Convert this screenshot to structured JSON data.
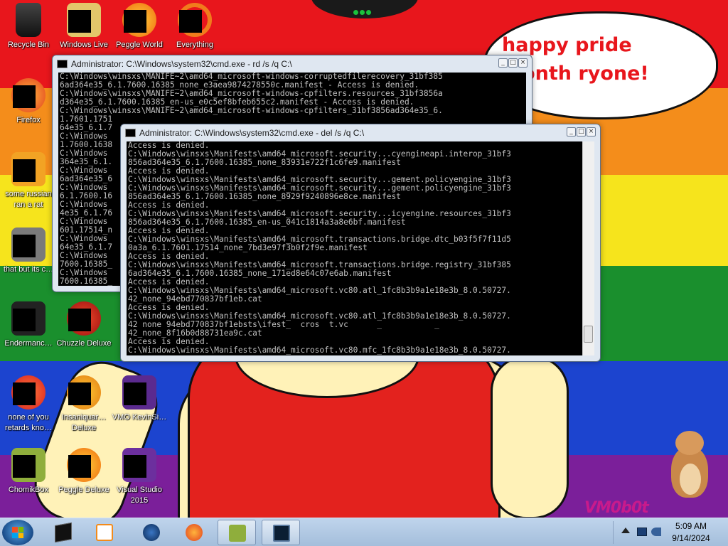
{
  "wallpaper": {
    "speech_bubble": "happy pride month ryone!",
    "watermark": "VM0b0t",
    "stripe_colors": [
      "#e8161c",
      "#f48d1b",
      "#f6e41c",
      "#1a8f2d",
      "#1c44cf",
      "#7b1f9a"
    ]
  },
  "desktop_icons": [
    {
      "label": "Recycle Bin",
      "icon": "recycle-bin-icon"
    },
    {
      "label": "Windows Live",
      "icon": "windows-live-icon"
    },
    {
      "label": "Peggle World",
      "icon": "peggle-world-icon"
    },
    {
      "label": "Everything",
      "icon": "everything-search-icon"
    },
    {
      "label": "Firefox",
      "icon": "firefox-icon"
    },
    {
      "label": "some russian ran a rat",
      "icon": "file-icon"
    },
    {
      "label": "that but its c…",
      "icon": "file-stack-icon"
    },
    {
      "label": "Endermanc…",
      "icon": "app-window-icon"
    },
    {
      "label": "Chuzzle Deluxe",
      "icon": "chuzzle-icon"
    },
    {
      "label": "none of you retards kno…",
      "icon": "browser-icon"
    },
    {
      "label": "Insaniquar… Deluxe",
      "icon": "insaniquarium-icon"
    },
    {
      "label": "VMO KevinSi…",
      "icon": "purple-app-icon"
    },
    {
      "label": "ChomikBox",
      "icon": "chomikbox-icon"
    },
    {
      "label": "Peggle Deluxe",
      "icon": "peggle-deluxe-icon"
    },
    {
      "label": "Visual Studio 2015",
      "icon": "visual-studio-icon"
    }
  ],
  "window_back": {
    "title": "Administrator: C:\\Windows\\system32\\cmd.exe - rd  /s /q C:\\",
    "lines": "C:\\Windows\\winsxs\\MANIFE~2\\amd64_microsoft-windows-corruptedfilerecovery_31bf385\n6ad364e35_6.1.7600.16385_none_e3aea9874278550c.manifest - Access is denied.\nC:\\Windows\\winsxs\\MANIFE~2\\amd64_microsoft-windows-cpfilters.resources_31bf3856a\nd364e35_6.1.7600.16385_en-us_e0c5ef8bfeb655c2.manifest - Access is denied.\nC:\\Windows\\winsxs\\MANIFE~2\\amd64_microsoft-windows-cpfilters_31bf3856ad364e35_6.\n1.7601.1751\n64e35_6.1.7\nC:\\Windows\n1.7600.1638\nC:\\Windows\n364e35_6.1.\nC:\\Windows\n6ad364e35_6\nC:\\Windows\n6.1.7600.16\nC:\\Windows\n4e35_6.1.76\nC:\\Windows\n601.17514_n\nC:\\Windows\n64e35_6.1.7\nC:\\Windows\n7600.16385_\nC:\\Windows\n7600.16385_"
  },
  "window_front": {
    "title": "Administrator: C:\\Windows\\system32\\cmd.exe - del  /s /q C:\\",
    "lines": "Access is denied.\nC:\\Windows\\winsxs\\Manifests\\amd64_microsoft.security...cyengineapi.interop_31bf3\n856ad364e35_6.1.7600.16385_none_83931e722f1c6fe9.manifest\nAccess is denied.\nC:\\Windows\\winsxs\\Manifests\\amd64_microsoft.security...gement.policyengine_31bf3\nC:\\Windows\\winsxs\\Manifests\\amd64_microsoft.security...gement.policyengine_31bf3\n856ad364e35_6.1.7600.16385_none_8929f9240896e8ce.manifest\nAccess is denied.\nC:\\Windows\\winsxs\\Manifests\\amd64_microsoft.security...icyengine.resources_31bf3\n856ad364e35_6.1.7600.16385_en-us_041c1814a3a8e6bf.manifest\nAccess is denied.\nC:\\Windows\\winsxs\\Manifests\\amd64_microsoft.transactions.bridge.dtc_b03f5f7f11d5\n0a3a_6.1.7601.17514_none_7bd3e97f3b0f2f9e.manifest\nAccess is denied.\nC:\\Windows\\winsxs\\Manifests\\amd64_microsoft.transactions.bridge.registry_31bf385\n6ad364e35_6.1.7600.16385_none_171ed8e64c07e6ab.manifest\nAccess is denied.\nC:\\Windows\\winsxs\\Manifests\\amd64_microsoft.vc80.atl_1fc8b3b9a1e18e3b_8.0.50727.\n42_none_94ebd770837bf1eb.cat\nAccess is denied.\nC:\\Windows\\winsxs\\Manifests\\amd64_microsoft.vc80.atl_1fc8b3b9a1e18e3b_8.0.50727.\n42 none 94ebd770837bf1ebsts\\ifest_  cros  t.vc      _           _\n42_none_8f16b0d88731ea9c.cat\nAccess is denied.\nC:\\Windows\\winsxs\\Manifests\\amd64_microsoft.vc80.mfc_1fc8b3b9a1e18e3b_8.0.50727."
  },
  "taskbar": {
    "pinned": [
      "cmd-icon",
      "media-player-icon",
      "globe-icon",
      "firefox-icon",
      "chomikbox-icon",
      "console-window-icon"
    ],
    "clock_time": "5:09 AM",
    "clock_date": "9/14/2024"
  }
}
